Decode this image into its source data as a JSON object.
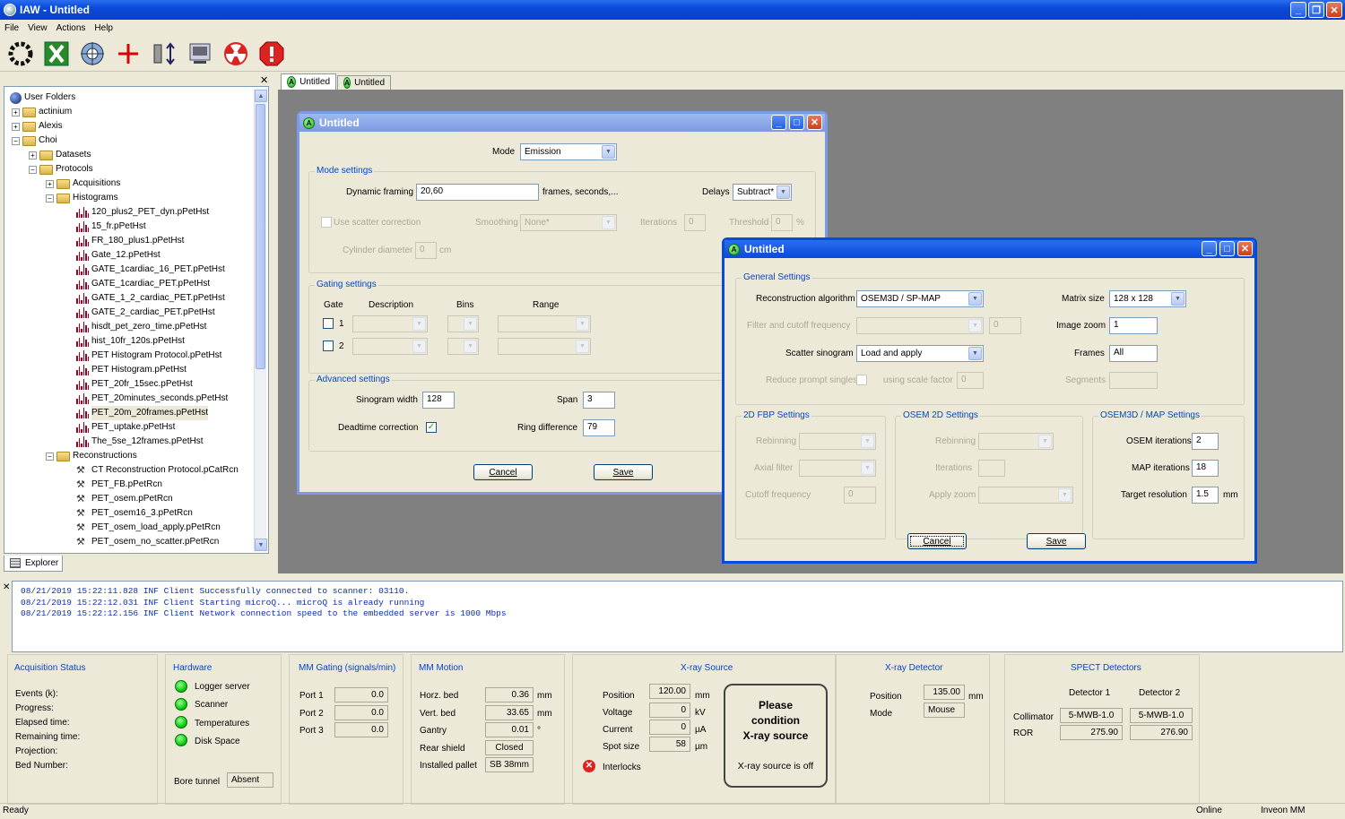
{
  "app": {
    "title": "IAW - Untitled"
  },
  "menu": [
    "File",
    "View",
    "Actions",
    "Help"
  ],
  "tabs": [
    "Untitled",
    "Untitled"
  ],
  "explorer": {
    "root": "User Folders",
    "tab": "Explorer",
    "folders": [
      "actinium",
      "Alexis",
      "Choi"
    ],
    "choi": [
      "Datasets",
      "Protocols"
    ],
    "protocols": [
      "Acquisitions",
      "Histograms"
    ],
    "histograms": [
      "120_plus2_PET_dyn.pPetHst",
      "15_fr.pPetHst",
      "FR_180_plus1.pPetHst",
      "Gate_12.pPetHst",
      "GATE_1cardiac_16_PET.pPetHst",
      "GATE_1cardiac_PET.pPetHst",
      "GATE_1_2_cardiac_PET.pPetHst",
      "GATE_2_cardiac_PET.pPetHst",
      "hisdt_pet_zero_time.pPetHst",
      "hist_10fr_120s.pPetHst",
      "PET Histogram Protocol.pPetHst",
      "PET Histogram.pPetHst",
      "PET_20fr_15sec.pPetHst",
      "PET_20minutes_seconds.pPetHst",
      "PET_20m_20frames.pPetHst",
      "PET_uptake.pPetHst",
      "The_5se_12frames.pPetHst"
    ],
    "reconstructions_label": "Reconstructions",
    "reconstructions": [
      "CT Reconstruction Protocol.pCatRcn",
      "PET_FB.pPetRcn",
      "PET_osem.pPetRcn",
      "PET_osem16_3.pPetRcn",
      "PET_osem_load_apply.pPetRcn",
      "PET_osem_no_scatter.pPetRcn"
    ]
  },
  "dlg1": {
    "title": "Untitled",
    "mode_label": "Mode",
    "mode_value": "Emission",
    "mode_settings": "Mode settings",
    "dyn_label": "Dynamic framing",
    "dyn_value": "20,60",
    "dyn_suffix": "frames, seconds,...",
    "delays_label": "Delays",
    "delays_value": "Subtract*",
    "scatter_label": "Use scatter correction",
    "smoothing_label": "Smoothing",
    "smoothing_value": "None*",
    "iterations_label": "Iterations",
    "iterations_value": "0",
    "threshold_label": "Threshold",
    "threshold_value": "0",
    "threshold_unit": "%",
    "cyl_label": "Cylinder diameter",
    "cyl_value": "0",
    "cyl_unit": "cm",
    "gating_settings": "Gating settings",
    "gate_h": "Gate",
    "desc_h": "Description",
    "bins_h": "Bins",
    "range_h": "Range",
    "gate1": "1",
    "gate2": "2",
    "advanced": "Advanced settings",
    "sino_label": "Sinogram width",
    "sino_value": "128",
    "span_label": "Span",
    "span_value": "3",
    "dead_label": "Deadtime correction",
    "ring_label": "Ring difference",
    "ring_value": "79",
    "cancel": "Cancel",
    "save": "Save"
  },
  "dlg2": {
    "title": "Untitled",
    "general": "General Settings",
    "recon_label": "Reconstruction algorithm",
    "recon_value": "OSEM3D / SP-MAP",
    "matrix_label": "Matrix size",
    "matrix_value": "128 x 128",
    "filter_label": "Filter and cutoff frequency",
    "filter_value": "0",
    "zoom_label": "Image zoom",
    "zoom_value": "1",
    "scatter_label": "Scatter sinogram",
    "scatter_value": "Load and apply",
    "frames_label": "Frames",
    "frames_value": "All",
    "reduce_label": "Reduce prompt singles",
    "scale_label": "using scale factor",
    "scale_value": "0",
    "segments_label": "Segments",
    "fbp": "2D FBP Settings",
    "rebin_label": "Rebinning",
    "axial_label": "Axial filter",
    "cutoff_label": "Cutoff frequency",
    "cutoff_value": "0",
    "osem2d": "OSEM 2D Settings",
    "rebin2_label": "Rebinning",
    "iter_label": "Iterations",
    "apply_zoom_label": "Apply zoom",
    "osem3d": "OSEM3D / MAP Settings",
    "osem_iter_label": "OSEM iterations",
    "osem_iter_value": "2",
    "map_iter_label": "MAP iterations",
    "map_iter_value": "18",
    "target_label": "Target resolution",
    "target_value": "1.5",
    "target_unit": "mm",
    "cancel": "Cancel",
    "save": "Save"
  },
  "log": [
    "08/21/2019 15:22:11.828 INF Client Successfully connected to scanner: 03110.",
    "08/21/2019 15:22:12.031 INF Client Starting microQ... microQ is already running",
    "08/21/2019 15:22:12.156 INF Client Network connection speed to the embedded server is 1000 Mbps"
  ],
  "acq": {
    "title": "Acquisition Status",
    "rows": [
      "Events (k):",
      "Progress:",
      "Elapsed time:",
      "Remaining time:",
      "Projection:",
      "Bed Number:"
    ]
  },
  "hardware": {
    "title": "Hardware",
    "items": [
      "Logger server",
      "Scanner",
      "Temperatures",
      "Disk Space"
    ],
    "bore_label": "Bore tunnel",
    "bore_value": "Absent"
  },
  "gating": {
    "title": "MM Gating (signals/min)",
    "ports": [
      {
        "label": "Port 1",
        "value": "0.0"
      },
      {
        "label": "Port 2",
        "value": "0.0"
      },
      {
        "label": "Port 3",
        "value": "0.0"
      }
    ]
  },
  "motion": {
    "title": "MM Motion",
    "horz_label": "Horz. bed",
    "horz_value": "0.36",
    "horz_unit": "mm",
    "vert_label": "Vert. bed",
    "vert_value": "33.65",
    "vert_unit": "mm",
    "gantry_label": "Gantry",
    "gantry_value": "0.01",
    "gantry_unit": "°",
    "rear_label": "Rear shield",
    "rear_value": "Closed",
    "pallet_label": "Installed pallet",
    "pallet_value": "SB 38mm"
  },
  "xray": {
    "title": "X-ray Source",
    "pos_label": "Position",
    "pos_value": "120.00",
    "pos_unit": "mm",
    "volt_label": "Voltage",
    "volt_value": "0",
    "volt_unit": "kV",
    "cur_label": "Current",
    "cur_value": "0",
    "cur_unit": "µA",
    "spot_label": "Spot size",
    "spot_value": "58",
    "spot_unit": "µm",
    "interlocks": "Interlocks",
    "msg1": "Please",
    "msg2": "condition",
    "msg3": "X-ray source",
    "msg4": "X-ray source is off"
  },
  "xdet": {
    "title": "X-ray Detector",
    "pos_label": "Position",
    "pos_value": "135.00",
    "pos_unit": "mm",
    "mode_label": "Mode",
    "mode_value": "Mouse"
  },
  "spect": {
    "title": "SPECT Detectors",
    "det1": "Detector 1",
    "det2": "Detector 2",
    "coll_label": "Collimator",
    "coll1": "5-MWB-1.0",
    "coll2": "5-MWB-1.0",
    "ror_label": "ROR",
    "ror1": "275.90",
    "ror2": "276.90"
  },
  "status": {
    "left": "Ready",
    "online": "Online",
    "product": "Inveon MM"
  }
}
